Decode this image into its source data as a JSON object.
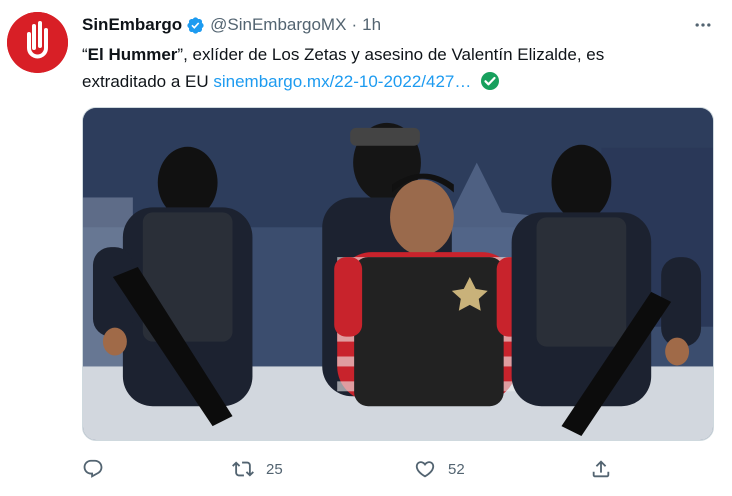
{
  "tweet": {
    "author_name": "SinEmbargo",
    "handle": "@SinEmbargoMX",
    "separator": "·",
    "time": "1h",
    "text_quote_open": "“",
    "text_bold": "El Hummer",
    "text_quote_close": "”",
    "text_line1_rest": ", exlíder de Los Zetas y asesino de Valentín Elizalde, es",
    "text_line2": "extraditado a EU",
    "link_text": "sinembargo.mx/22-10-2022/427…"
  },
  "actions": {
    "reply_count": "",
    "retweet_count": "25",
    "like_count": "52"
  },
  "icons": {
    "verified": "verified-badge-icon",
    "more": "more-dots-icon",
    "link_check": "check-circle-icon",
    "reply": "reply-icon",
    "retweet": "retweet-icon",
    "like": "heart-icon",
    "share": "share-icon"
  },
  "colors": {
    "link": "#1d9bf0",
    "muted": "#536471",
    "text": "#0f1419",
    "avatar_bg": "#d81f26",
    "check_green": "#17a05d"
  }
}
